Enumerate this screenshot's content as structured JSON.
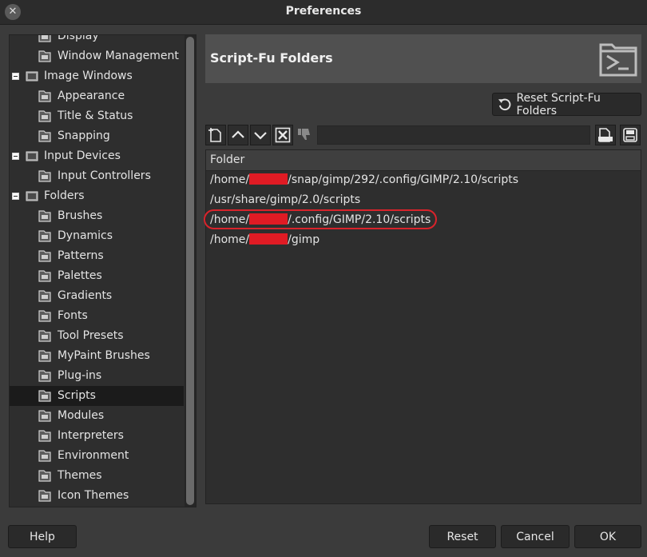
{
  "window": {
    "title": "Preferences",
    "close_glyph": "✕"
  },
  "tree": {
    "items": [
      {
        "label": "Display",
        "icon": "display-icon",
        "level": 2
      },
      {
        "label": "Window Management",
        "icon": "window-management-icon",
        "level": 2
      },
      {
        "label": "Image Windows",
        "icon": "image-windows-icon",
        "level": 1,
        "expanded": true
      },
      {
        "label": "Appearance",
        "icon": "appearance-icon",
        "level": 2
      },
      {
        "label": "Title & Status",
        "icon": "title-status-icon",
        "level": 2
      },
      {
        "label": "Snapping",
        "icon": "snapping-icon",
        "level": 2
      },
      {
        "label": "Input Devices",
        "icon": "input-devices-icon",
        "level": 1,
        "expanded": true
      },
      {
        "label": "Input Controllers",
        "icon": "input-controllers-icon",
        "level": 2
      },
      {
        "label": "Folders",
        "icon": "folders-icon",
        "level": 1,
        "expanded": true
      },
      {
        "label": "Brushes",
        "icon": "brushes-folder-icon",
        "level": 2
      },
      {
        "label": "Dynamics",
        "icon": "dynamics-folder-icon",
        "level": 2
      },
      {
        "label": "Patterns",
        "icon": "patterns-folder-icon",
        "level": 2
      },
      {
        "label": "Palettes",
        "icon": "palettes-folder-icon",
        "level": 2
      },
      {
        "label": "Gradients",
        "icon": "gradients-folder-icon",
        "level": 2
      },
      {
        "label": "Fonts",
        "icon": "fonts-folder-icon",
        "level": 2
      },
      {
        "label": "Tool Presets",
        "icon": "tool-presets-folder-icon",
        "level": 2
      },
      {
        "label": "MyPaint Brushes",
        "icon": "mypaint-brushes-folder-icon",
        "level": 2
      },
      {
        "label": "Plug-ins",
        "icon": "plugins-folder-icon",
        "level": 2
      },
      {
        "label": "Scripts",
        "icon": "scripts-folder-icon",
        "level": 2,
        "selected": true
      },
      {
        "label": "Modules",
        "icon": "modules-folder-icon",
        "level": 2
      },
      {
        "label": "Interpreters",
        "icon": "interpreters-folder-icon",
        "level": 2
      },
      {
        "label": "Environment",
        "icon": "environment-folder-icon",
        "level": 2
      },
      {
        "label": "Themes",
        "icon": "themes-folder-icon",
        "level": 2
      },
      {
        "label": "Icon Themes",
        "icon": "icon-themes-folder-icon",
        "level": 2
      }
    ],
    "scroll_position": 0.93
  },
  "page": {
    "title": "Script-Fu Folders",
    "header_icon": "script-terminal-icon",
    "reset_folders_label": "Reset Script-Fu Folders"
  },
  "toolbar": {
    "buttons": [
      "new-folder-icon",
      "move-up-icon",
      "move-down-icon",
      "delete-icon",
      "thumbs-down-icon"
    ],
    "path_value": "",
    "browse_icon": "browse-folder-icon",
    "save_icon": "save-icon"
  },
  "folder_list": {
    "column_header": "Folder",
    "rows": [
      {
        "prefix": "/home/",
        "redacted": true,
        "suffix": "/snap/gimp/292/.config/GIMP/2.10/scripts"
      },
      {
        "prefix": "/usr/share/gimp/2.0/scripts",
        "redacted": false,
        "suffix": ""
      },
      {
        "prefix": "/home/",
        "redacted": true,
        "suffix": "/.config/GIMP/2.10/scripts",
        "highlighted": true
      },
      {
        "prefix": "/home/",
        "redacted": true,
        "suffix": "/gimp"
      }
    ]
  },
  "footer": {
    "help_label": "Help",
    "reset_label": "Reset",
    "cancel_label": "Cancel",
    "ok_label": "OK"
  },
  "colors": {
    "background": "#3b3b3b",
    "highlight_oval": "#d9232b",
    "redaction": "#e01b24"
  }
}
